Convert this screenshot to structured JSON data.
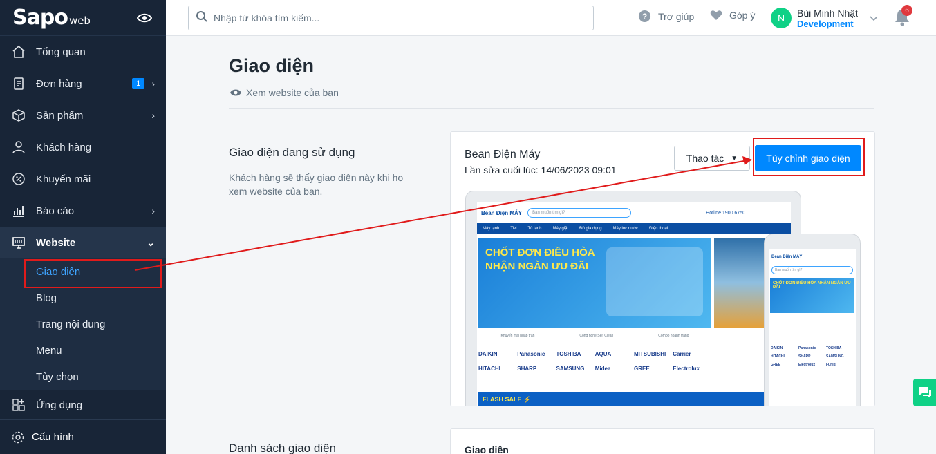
{
  "brand": {
    "logo": "Sapo",
    "logo_suffix": "web"
  },
  "sidebar": {
    "items": [
      {
        "label": "Tổng quan",
        "icon": "home-icon"
      },
      {
        "label": "Đơn hàng",
        "icon": "orders-icon",
        "badge": "1"
      },
      {
        "label": "Sản phẩm",
        "icon": "box-icon"
      },
      {
        "label": "Khách hàng",
        "icon": "user-icon"
      },
      {
        "label": "Khuyến mãi",
        "icon": "percent-icon"
      },
      {
        "label": "Báo cáo",
        "icon": "chart-icon"
      },
      {
        "label": "Website",
        "icon": "monitor-icon"
      }
    ],
    "website_sub": [
      "Giao diện",
      "Blog",
      "Trang nội dung",
      "Menu",
      "Tùy chọn"
    ],
    "apps": "Ứng dụng",
    "settings": "Cấu hình"
  },
  "header": {
    "search_placeholder": "Nhập từ khóa tìm kiếm...",
    "help": "Trợ giúp",
    "feedback": "Góp ý",
    "avatar_initial": "N",
    "user_name": "Bùi Minh Nhật",
    "user_role": "Development",
    "notification_count": "6"
  },
  "main": {
    "title": "Giao diện",
    "view_site": "Xem website của bạn",
    "current_section_title": "Giao diện đang sử dụng",
    "current_section_desc": "Khách hàng sẽ thấy giao diện này khi họ xem website của bạn.",
    "theme_name": "Bean Điện Máy",
    "theme_modified": "Lần sửa cuối lúc: 14/06/2023 09:01",
    "actions_label": "Thao tác",
    "customize_label": "Tùy chỉnh giao diện",
    "list_section_title": "Danh sách giao diện",
    "list_card_title": "Giao diện"
  },
  "preview": {
    "site_logo": "Bean Điện MÁY",
    "site_search": "Bạn muốn tìm gì?",
    "hotline": "Hotline 1900 6750",
    "nav": [
      "Máy lạnh",
      "Tivi",
      "Tủ lạnh",
      "Máy giặt",
      "Đồ gia dụng",
      "Máy lọc nước",
      "Điện thoại"
    ],
    "hero_line1": "CHỐT ĐƠN ĐIỀU HÒA",
    "hero_line2": "NHẬN NGÀN ƯU ĐÃI",
    "sub_row": [
      "Khuyến mãi ngập tràn",
      "Công nghệ Self Clean",
      "Combo hoành tráng"
    ],
    "brands": [
      "DAIKIN",
      "Panasonic",
      "TOSHIBA",
      "AQUA",
      "MITSUBISHI",
      "Carrier",
      "HITACHI",
      "SHARP",
      "SAMSUNG",
      "Midea",
      "GREE",
      "Electrolux"
    ],
    "flash_sale": "FLASH SALE ⚡",
    "phone_logo": "Bean Điện MÁY",
    "phone_search": "Bạn muốn tìm gì?",
    "phone_hero": "CHỐT ĐƠN ĐIỀU HÒA NHẬN NGÀN ƯU ĐÃI",
    "phone_brands": [
      "DAIKIN",
      "Panasonic",
      "TOSHIBA",
      "HITACHI",
      "SHARP",
      "SAMSUNG",
      "GREE",
      "Electrolux",
      "Funiki"
    ]
  },
  "colors": {
    "sidebar_bg": "#182537",
    "accent": "#0088ff",
    "highlight": "#e01b1b"
  }
}
